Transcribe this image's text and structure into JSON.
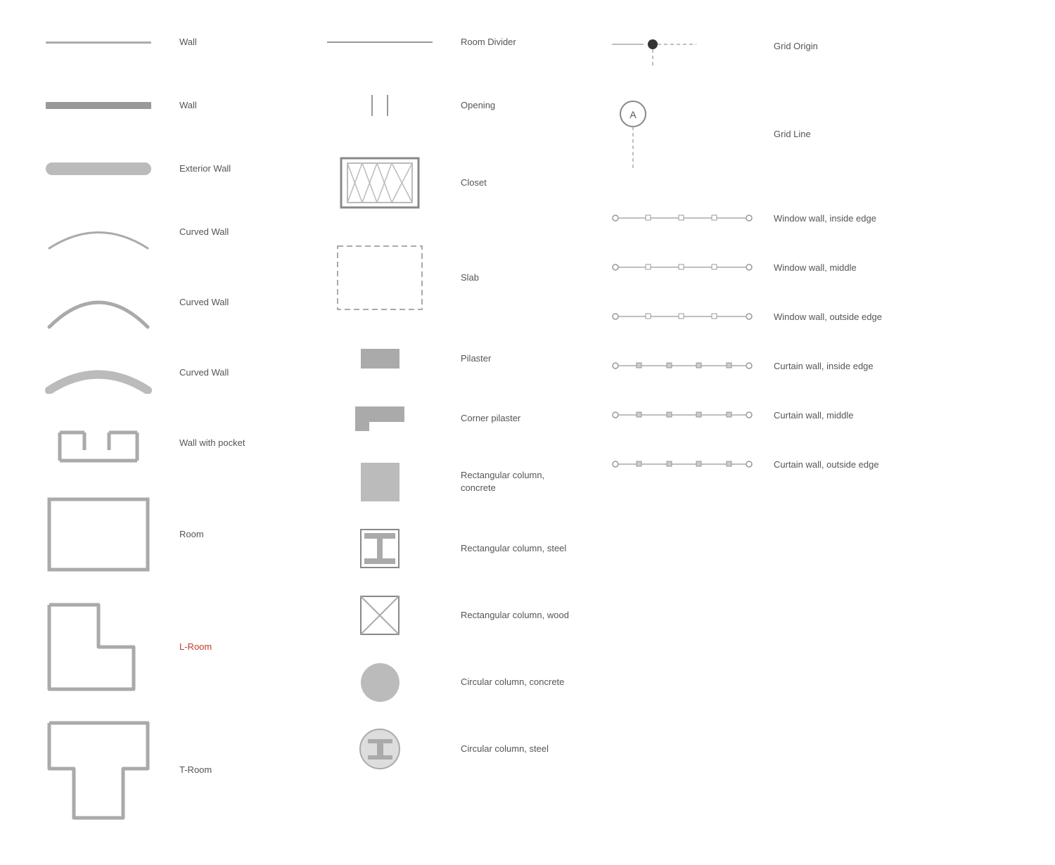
{
  "col1": {
    "items": [
      {
        "label": "Wall",
        "type": "wall-thin"
      },
      {
        "label": "Wall",
        "type": "wall-thick"
      },
      {
        "label": "Exterior Wall",
        "type": "wall-exterior"
      },
      {
        "label": "Curved Wall",
        "type": "curved-arc-thin"
      },
      {
        "label": "Curved Wall",
        "type": "curved-arc-medium"
      },
      {
        "label": "Curved Wall",
        "type": "curved-arc-thick"
      },
      {
        "label": "Wall with pocket",
        "type": "wall-pocket"
      },
      {
        "label": "Room",
        "type": "room"
      },
      {
        "label": "L-Room",
        "type": "l-room"
      },
      {
        "label": "T-Room",
        "type": "t-room"
      }
    ]
  },
  "col2": {
    "items": [
      {
        "label": "Room Divider",
        "type": "room-divider"
      },
      {
        "label": "Opening",
        "type": "opening"
      },
      {
        "label": "Closet",
        "type": "closet"
      },
      {
        "label": "Slab",
        "type": "slab"
      },
      {
        "label": "Pilaster",
        "type": "pilaster"
      },
      {
        "label": "Corner pilaster",
        "type": "corner-pilaster"
      },
      {
        "label": "Rectangular column,\nconcrete",
        "type": "rect-col-concrete"
      },
      {
        "label": "Rectangular column, steel",
        "type": "rect-col-steel"
      },
      {
        "label": "Rectangular column, wood",
        "type": "rect-col-wood"
      },
      {
        "label": "Circular column, concrete",
        "type": "circ-col-concrete"
      },
      {
        "label": "Circular column, steel",
        "type": "circ-col-steel"
      }
    ]
  },
  "col3": {
    "items": [
      {
        "label": "Grid Origin",
        "type": "grid-origin"
      },
      {
        "label": "Grid Line",
        "type": "grid-line"
      },
      {
        "label": "Window wall, inside edge",
        "type": "ww-inside"
      },
      {
        "label": "Window wall, middle",
        "type": "ww-middle"
      },
      {
        "label": "Window wall, outside edge",
        "type": "ww-outside"
      },
      {
        "label": "Curtain wall, inside edge",
        "type": "cw-inside"
      },
      {
        "label": "Curtain wall, middle",
        "type": "cw-middle"
      },
      {
        "label": "Curtain wall, outside edge",
        "type": "cw-outside"
      }
    ]
  }
}
